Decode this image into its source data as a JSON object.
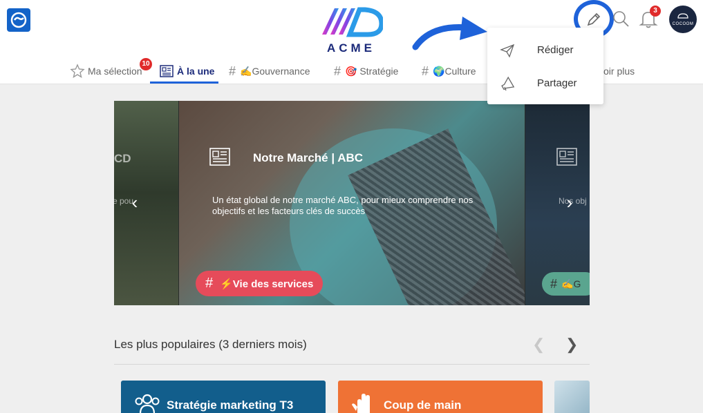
{
  "header": {
    "brand": "ACME",
    "notifications_count": "3",
    "avatar_text": "COCOOM"
  },
  "tabs": [
    {
      "label": "Ma sélection",
      "badge": "10",
      "icon": "star-icon"
    },
    {
      "label": "À la une",
      "icon": "newspaper-icon"
    },
    {
      "label": "✍️Gouvernance",
      "icon": "hash-icon"
    },
    {
      "label": "🎯 Stratégie",
      "icon": "hash-icon"
    },
    {
      "label": "🌍Culture",
      "icon": "hash-icon"
    },
    {
      "label": "oir plus"
    }
  ],
  "dropdown": {
    "items": [
      {
        "label": "Rédiger",
        "icon": "paper-plane-icon"
      },
      {
        "label": "Partager",
        "icon": "megaphone-icon"
      }
    ]
  },
  "carousel": {
    "left": {
      "title_fragment": "CD",
      "desc_fragment": "e pou"
    },
    "main": {
      "title": "Notre Marché | ABC",
      "description": "Un état global de notre marché ABC, pour mieux comprendre nos objectifs et les facteurs clés de succès",
      "tag": "⚡Vie des services"
    },
    "right": {
      "desc_fragment": "Nos obj",
      "tag_fragment": "✍️G"
    }
  },
  "popular": {
    "title": "Les plus populaires (3 derniers mois)",
    "cards": [
      {
        "title": "Stratégie marketing T3",
        "color": "#125e8c",
        "icon": "group-icon"
      },
      {
        "title": "Coup de main",
        "color": "#ef7235",
        "icon": "hand-icon"
      }
    ]
  },
  "colors": {
    "accent": "#1e62d9",
    "brand_dark": "#1b2a7a",
    "tag_red": "#e64b5a",
    "badge_red": "#e02b2b"
  }
}
